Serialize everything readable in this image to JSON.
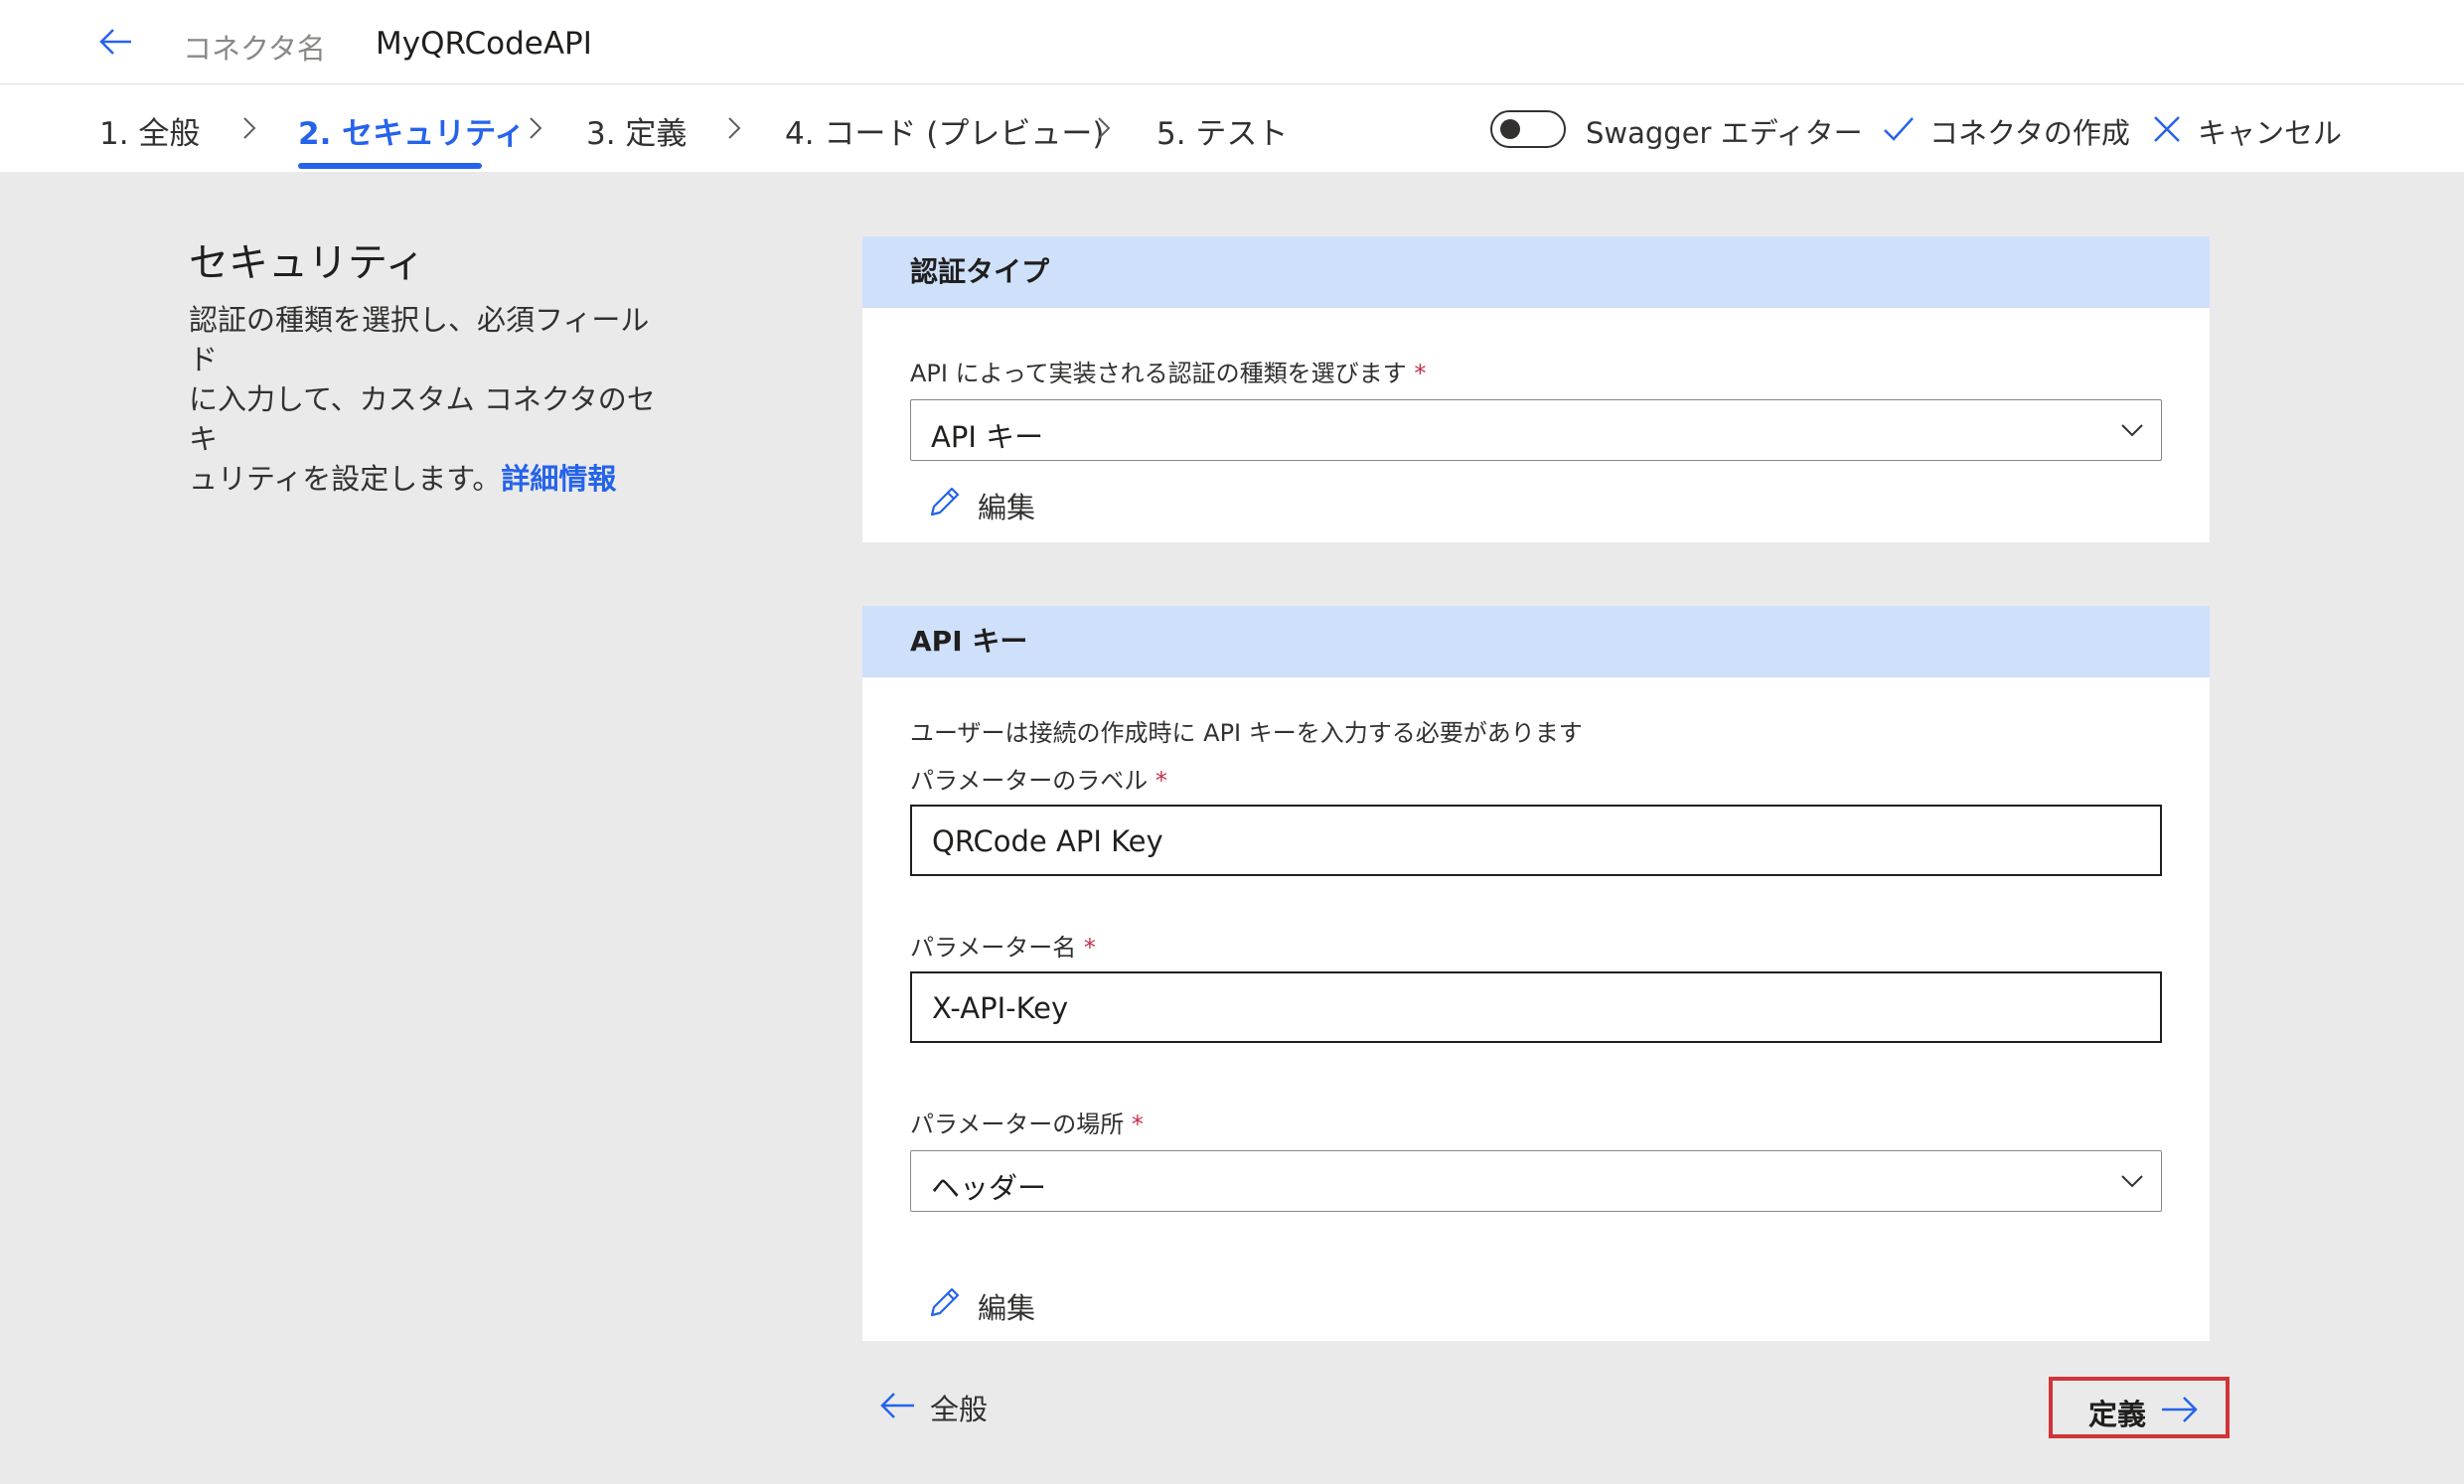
{
  "header": {
    "connector_label": "コネクタ名",
    "connector_name": "MyQRCodeAPI"
  },
  "steps": [
    {
      "label": "1. 全般",
      "active": false
    },
    {
      "label": "2. セキュリティ",
      "active": true
    },
    {
      "label": "3. 定義",
      "active": false
    },
    {
      "label": "4. コード (プレビュー)",
      "active": false
    },
    {
      "label": "5. テスト",
      "active": false
    }
  ],
  "toolbar": {
    "swagger_label": "Swagger エディター",
    "swagger_enabled": false,
    "create_label": "コネクタの作成",
    "cancel_label": "キャンセル"
  },
  "sidebar": {
    "title": "セキュリティ",
    "description_lines": [
      "認証の種類を選択し、必須フィールド",
      "に入力して、カスタム コネクタのセキ",
      "ュリティを設定します。"
    ],
    "learn_more": "詳細情報"
  },
  "auth_card": {
    "header": "認証タイプ",
    "field_label": "API によって実装される認証の種類を選びます",
    "required_mark": "*",
    "selected": "API キー",
    "edit_label": "編集"
  },
  "apikey_card": {
    "header": "API キー",
    "note": "ユーザーは接続の作成時に API キーを入力する必要があります",
    "param_label_label": "パラメーターのラベル",
    "param_label_value": "QRCode API Key",
    "param_name_label": "パラメーター名",
    "param_name_value": "X-API-Key",
    "param_location_label": "パラメーターの場所",
    "param_location_value": "ヘッダー",
    "required_mark": "*",
    "edit_label": "編集"
  },
  "footer": {
    "back_label": "全般",
    "next_label": "定義"
  },
  "colors": {
    "accent": "#2563eb",
    "card_header": "#cfe0fb",
    "background": "#eaeaea",
    "highlight": "#d13438"
  }
}
